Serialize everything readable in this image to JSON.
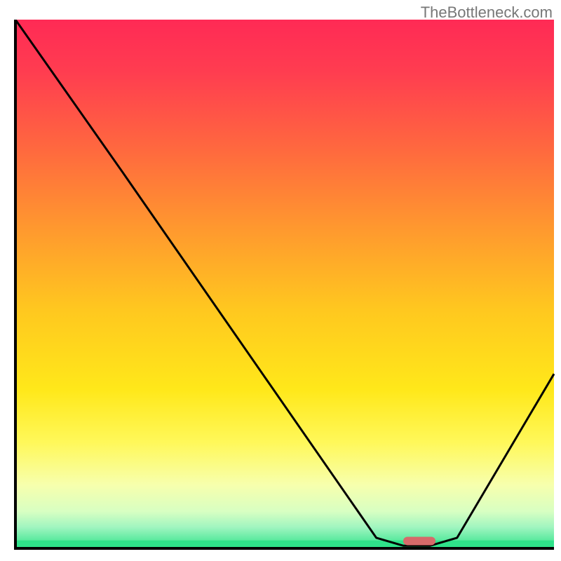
{
  "watermark": "TheBottleneck.com",
  "chart_data": {
    "type": "line",
    "title": "",
    "xlabel": "",
    "ylabel": "",
    "xlim": [
      0,
      100
    ],
    "ylim": [
      0,
      100
    ],
    "curve": [
      {
        "x": 0,
        "y": 100
      },
      {
        "x": 20,
        "y": 71
      },
      {
        "x": 67,
        "y": 2
      },
      {
        "x": 72,
        "y": 0.5
      },
      {
        "x": 77,
        "y": 0.5
      },
      {
        "x": 82,
        "y": 2
      },
      {
        "x": 100,
        "y": 33
      }
    ],
    "marker": {
      "x_start": 72,
      "x_end": 78,
      "y": 1.4
    },
    "gradient_stops": [
      {
        "offset": 0.0,
        "color": "#ff2a55"
      },
      {
        "offset": 0.1,
        "color": "#ff3d50"
      },
      {
        "offset": 0.25,
        "color": "#ff6a3e"
      },
      {
        "offset": 0.4,
        "color": "#ff9a2e"
      },
      {
        "offset": 0.55,
        "color": "#ffc81f"
      },
      {
        "offset": 0.7,
        "color": "#ffe81a"
      },
      {
        "offset": 0.8,
        "color": "#fff85a"
      },
      {
        "offset": 0.88,
        "color": "#f7ffad"
      },
      {
        "offset": 0.93,
        "color": "#d8ffc2"
      },
      {
        "offset": 0.96,
        "color": "#a0f5c0"
      },
      {
        "offset": 1.0,
        "color": "#2fe28a"
      }
    ],
    "axis_color": "#000000",
    "line_color": "#000000",
    "marker_color": "#d66a6a"
  }
}
